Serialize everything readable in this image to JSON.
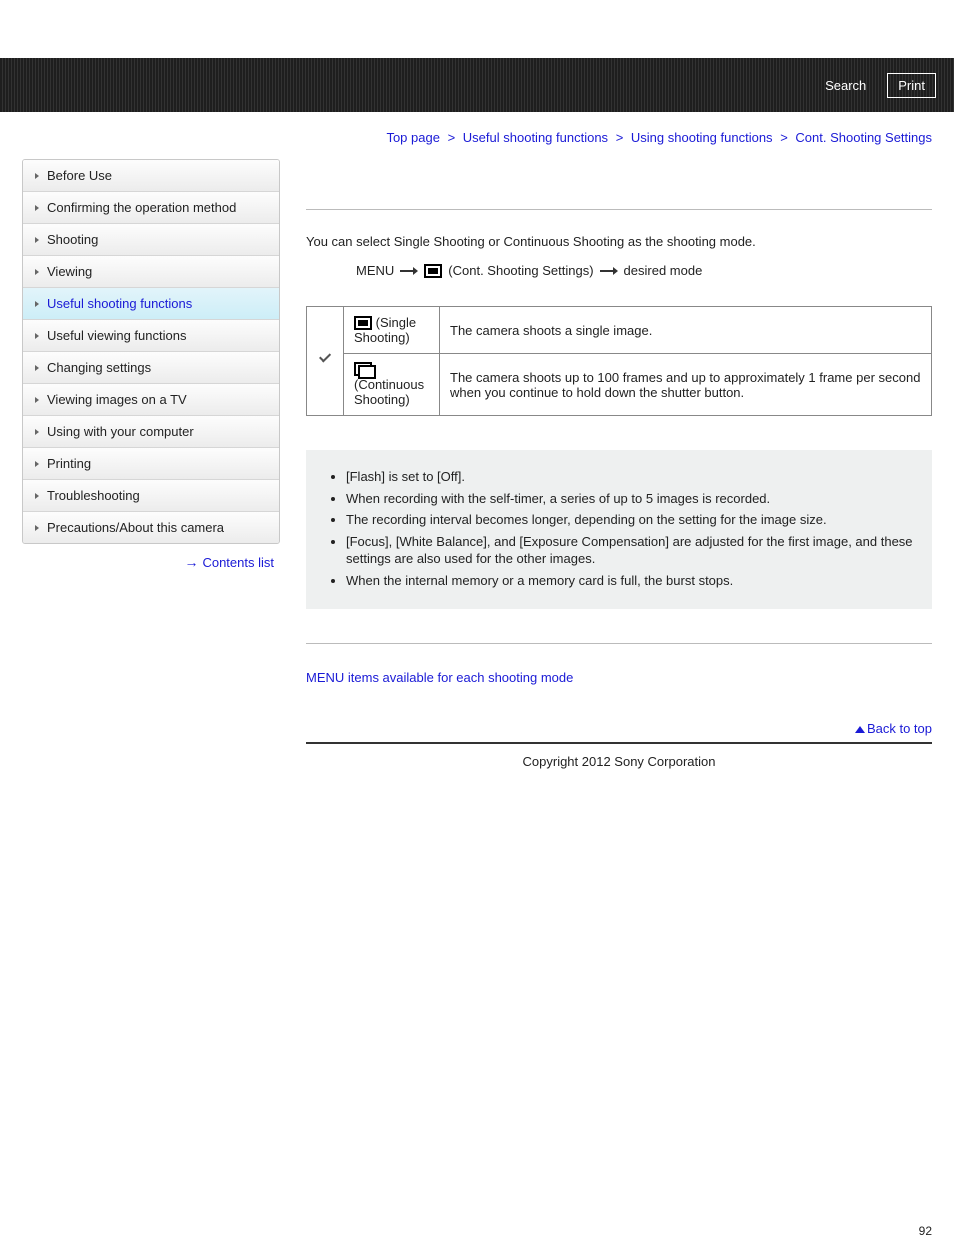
{
  "topbar": {
    "search": "Search",
    "print": "Print"
  },
  "breadcrumb": {
    "items": [
      "Top page",
      "Useful shooting functions",
      "Using shooting functions"
    ],
    "current": "Cont. Shooting Settings",
    "sep": ">"
  },
  "sidebar": {
    "items": [
      {
        "label": "Before Use"
      },
      {
        "label": "Confirming the operation method"
      },
      {
        "label": "Shooting"
      },
      {
        "label": "Viewing"
      },
      {
        "label": "Useful shooting functions",
        "active": true
      },
      {
        "label": "Useful viewing functions"
      },
      {
        "label": "Changing settings"
      },
      {
        "label": "Viewing images on a TV"
      },
      {
        "label": "Using with your computer"
      },
      {
        "label": "Printing"
      },
      {
        "label": "Troubleshooting"
      },
      {
        "label": "Precautions/About this camera"
      }
    ],
    "contents_list": "Contents list"
  },
  "main": {
    "intro": "You can select Single Shooting or Continuous Shooting as the shooting mode.",
    "menu_path": {
      "menu": "MENU",
      "section": "(Cont. Shooting Settings)",
      "target": "desired mode"
    },
    "table": {
      "rows": [
        {
          "mode": "(Single Shooting)",
          "desc": "The camera shoots a single image.",
          "checked": true,
          "icon": "single"
        },
        {
          "mode": "(Continuous Shooting)",
          "desc": "The camera shoots up to 100 frames and up to approximately 1 frame per second when you continue to hold down the shutter button.",
          "checked": false,
          "icon": "continuous"
        }
      ]
    },
    "notes": [
      "[Flash] is set to [Off].",
      "When recording with the self-timer, a series of up to 5 images is recorded.",
      "The recording interval becomes longer, depending on the setting for the image size.",
      "[Focus], [White Balance], and [Exposure Compensation] are adjusted for the first image, and these settings are also used for the other images.",
      "When the internal memory or a memory card is full, the burst stops."
    ],
    "related_link": "MENU items available for each shooting mode",
    "back_to_top": "Back to top"
  },
  "footer": {
    "copyright": "Copyright 2012 Sony Corporation"
  },
  "page_number": "92"
}
